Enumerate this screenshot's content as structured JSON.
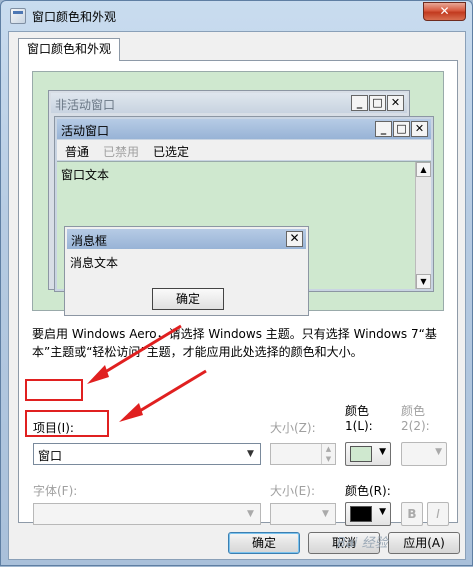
{
  "window": {
    "title": "窗口颜色和外观",
    "close_label": "✕"
  },
  "tab": {
    "label": "窗口颜色和外观"
  },
  "preview": {
    "inactive_title": "非活动窗口",
    "active_title": "活动窗口",
    "menu": {
      "normal": "普通",
      "disabled": "已禁用",
      "selected": "已选定"
    },
    "window_text": "窗口文本",
    "msgbox_title": "消息框",
    "msgbox_text": "消息文本",
    "msgbox_ok": "确定",
    "background_color": "#cfe8cf"
  },
  "note": "要启用 Windows Aero，请选择 Windows 主题。只有选择 Windows 7“基本”主题或“轻松访问”主题，才能应用此处选择的颜色和大小。",
  "item": {
    "label": "项目(I):",
    "value": "窗口",
    "size_label": "大小(Z):",
    "color1_label": "颜色",
    "color1_sub": "1(L):",
    "color1_value": "#cfe8cf",
    "color2_label": "颜色",
    "color2_sub": "2(2):"
  },
  "font": {
    "label": "字体(F):",
    "value": "",
    "size_label": "大小(E):",
    "color_label": "颜色(R):",
    "color_value": "#000000",
    "bold": "B",
    "italic": "I"
  },
  "buttons": {
    "ok": "确定",
    "cancel": "取消",
    "apply": "应用(A)"
  },
  "watermark": "Bai 经验"
}
